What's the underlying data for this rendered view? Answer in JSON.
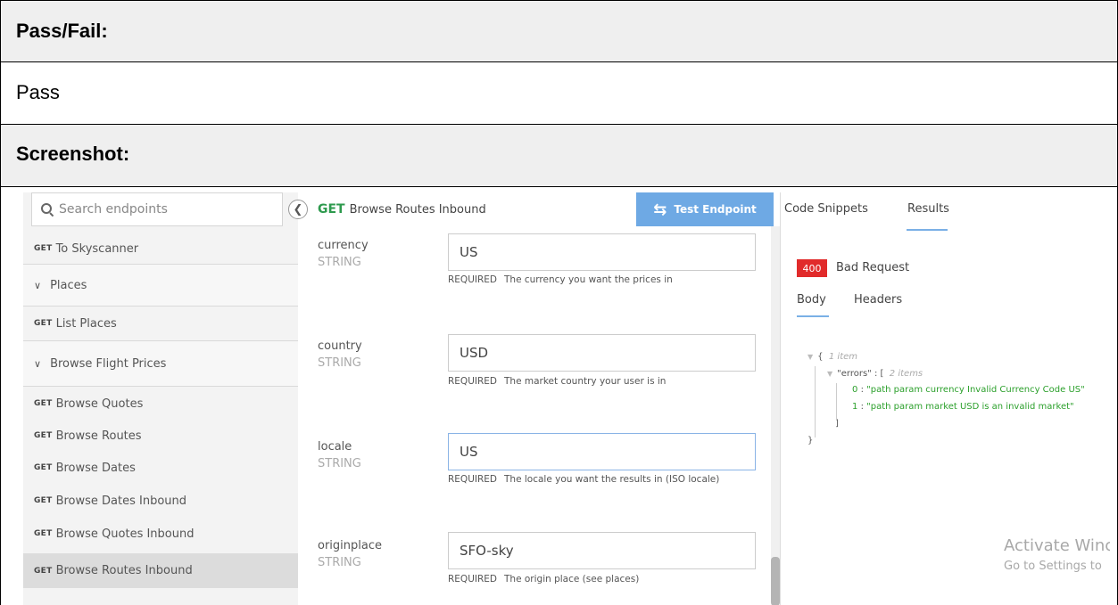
{
  "table": {
    "pass_fail_header": "Pass/Fail:",
    "pass_fail_value": "Pass",
    "screenshot_header": "Screenshot:"
  },
  "sidebar": {
    "search_placeholder": "Search endpoints",
    "items": [
      {
        "verb": "GET",
        "label": "To Skyscanner"
      },
      {
        "group": true,
        "label": "Places"
      },
      {
        "verb": "GET",
        "label": "List Places"
      },
      {
        "group": true,
        "label": "Browse Flight Prices"
      },
      {
        "verb": "GET",
        "label": "Browse Quotes"
      },
      {
        "verb": "GET",
        "label": "Browse Routes"
      },
      {
        "verb": "GET",
        "label": "Browse Dates"
      },
      {
        "verb": "GET",
        "label": "Browse Dates Inbound"
      },
      {
        "verb": "GET",
        "label": "Browse Quotes Inbound"
      },
      {
        "verb": "GET",
        "label": "Browse Routes Inbound",
        "active": true
      }
    ]
  },
  "endpoint": {
    "verb": "GET",
    "title": "Browse Routes Inbound",
    "test_button": "Test Endpoint"
  },
  "params": [
    {
      "name": "currency",
      "type": "STRING",
      "value": "US",
      "required": "REQUIRED",
      "desc": "The currency you want the prices in"
    },
    {
      "name": "country",
      "type": "STRING",
      "value": "USD",
      "required": "REQUIRED",
      "desc": "The market country your user is in"
    },
    {
      "name": "locale",
      "type": "STRING",
      "value": "US",
      "required": "REQUIRED",
      "desc": "The locale you want the results in (ISO locale)"
    },
    {
      "name": "originplace",
      "type": "STRING",
      "value": "SFO-sky",
      "required": "REQUIRED",
      "desc": "The origin place (see places)"
    }
  ],
  "results": {
    "tabs": [
      "Code Snippets",
      "Results"
    ],
    "status_code": "400",
    "status_text": "Bad Request",
    "subtabs": [
      "Body",
      "Headers"
    ],
    "json": {
      "open_brace": "{",
      "root_meta": "1 item",
      "errors_key": "\"errors\"",
      "colon": ":",
      "open_bracket": "[",
      "errors_meta": "2 items",
      "error_items": [
        {
          "index": "0",
          "text": "\"path param currency Invalid Currency Code US\""
        },
        {
          "index": "1",
          "text": "\"path param market USD is an invalid market\""
        }
      ],
      "close_bracket": "]",
      "close_brace": "}"
    },
    "watermark_line1": "Activate Winc",
    "watermark_line2": "Go to Settings to"
  },
  "colors": {
    "accent_blue": "#6ea9e4",
    "get_green": "#2e9a4e",
    "error_red": "#e12b2b",
    "json_green": "#2ca02c"
  }
}
